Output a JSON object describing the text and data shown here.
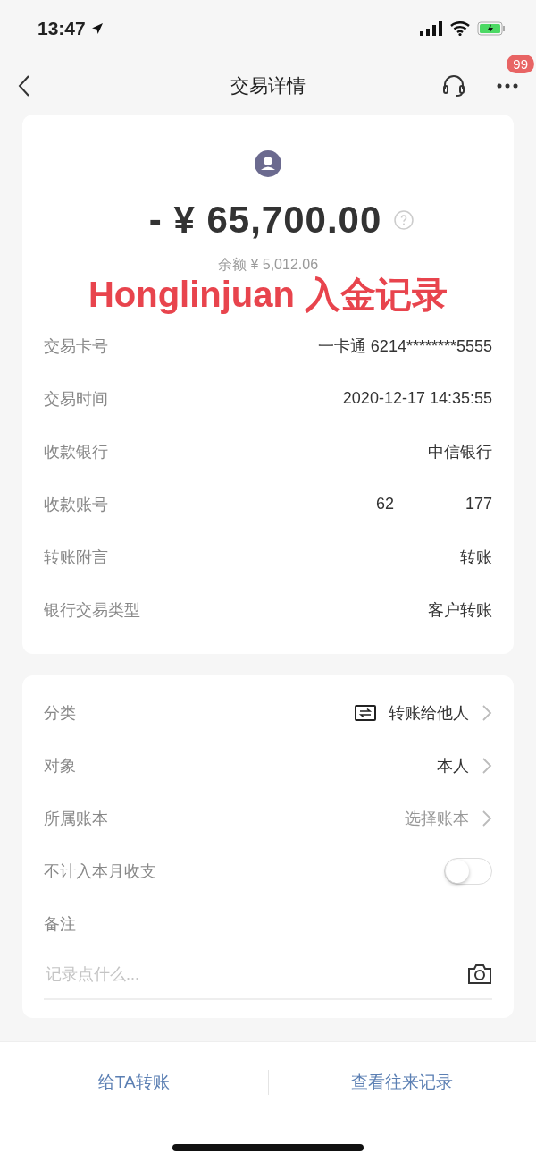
{
  "status_bar": {
    "time": "13:47"
  },
  "nav": {
    "title": "交易详情",
    "badge": "99"
  },
  "summary": {
    "amount": "- ¥ 65,700.00",
    "balance": "余额 ¥ 5,012.06",
    "annotation": "Honglinjuan 入金记录"
  },
  "details": [
    {
      "kind": "text",
      "label": "交易卡号",
      "value": "一卡通 6214********5555"
    },
    {
      "kind": "text",
      "label": "交易时间",
      "value": "2020-12-17 14:35:55"
    },
    {
      "kind": "text",
      "label": "收款银行",
      "value": "中信银行"
    },
    {
      "kind": "masked",
      "label": "收款账号",
      "value_start": "62",
      "value_end": "177"
    },
    {
      "kind": "text",
      "label": "转账附言",
      "value": "转账"
    },
    {
      "kind": "text",
      "label": "银行交易类型",
      "value": "客户转账"
    }
  ],
  "settings": [
    {
      "kind": "icon-link",
      "label": "分类",
      "value": "转账给他人",
      "muted": false
    },
    {
      "kind": "link",
      "label": "对象",
      "value": "本人",
      "muted": false
    },
    {
      "kind": "link",
      "label": "所属账本",
      "value": "选择账本",
      "muted": true
    },
    {
      "kind": "toggle",
      "label": "不计入本月收支",
      "on": false
    },
    {
      "kind": "note",
      "label": "备注",
      "placeholder": "记录点什么..."
    }
  ],
  "actions": [
    "给TA转账",
    "查看往来记录"
  ]
}
